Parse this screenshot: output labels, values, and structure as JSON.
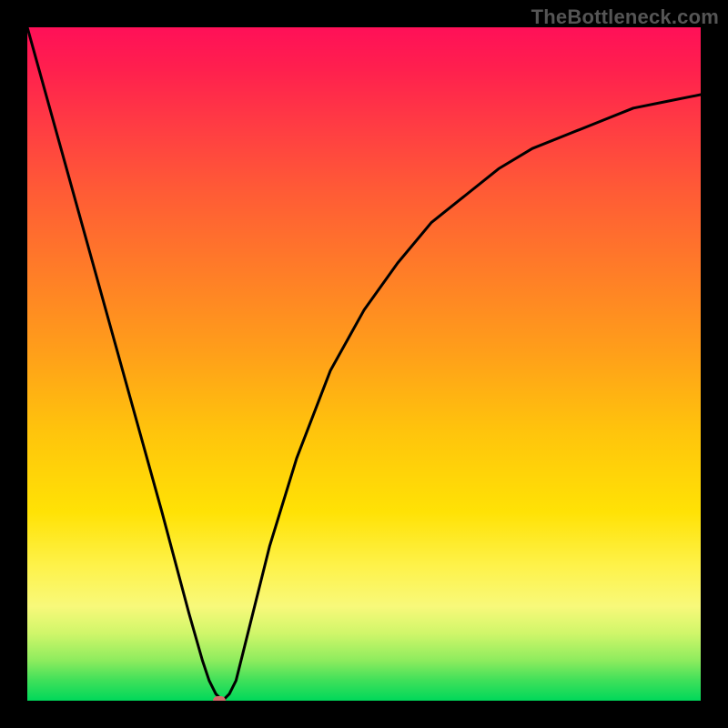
{
  "watermark": "TheBottleneck.com",
  "chart_data": {
    "type": "line",
    "title": "",
    "xlabel": "",
    "ylabel": "",
    "xlim": [
      0,
      100
    ],
    "ylim": [
      0,
      100
    ],
    "grid": false,
    "legend": false,
    "series": [
      {
        "name": "bottleneck-curve",
        "x": [
          0,
          5,
          10,
          15,
          20,
          24,
          26,
          27,
          28,
          29,
          30,
          31,
          32,
          34,
          36,
          40,
          45,
          50,
          55,
          60,
          65,
          70,
          75,
          80,
          85,
          90,
          95,
          100
        ],
        "y": [
          100,
          82,
          64,
          46,
          28,
          13,
          6,
          3,
          1,
          0,
          1,
          3,
          7,
          15,
          23,
          36,
          49,
          58,
          65,
          71,
          75,
          79,
          82,
          84,
          86,
          88,
          89,
          90
        ]
      }
    ],
    "marker": {
      "x": 28.5,
      "y": 0,
      "color": "#d46a6a"
    }
  },
  "colors": {
    "background": "#000000",
    "curve": "#000000",
    "watermark": "#555555",
    "gradient_top": "#ff1058",
    "gradient_bottom": "#00d85a"
  }
}
